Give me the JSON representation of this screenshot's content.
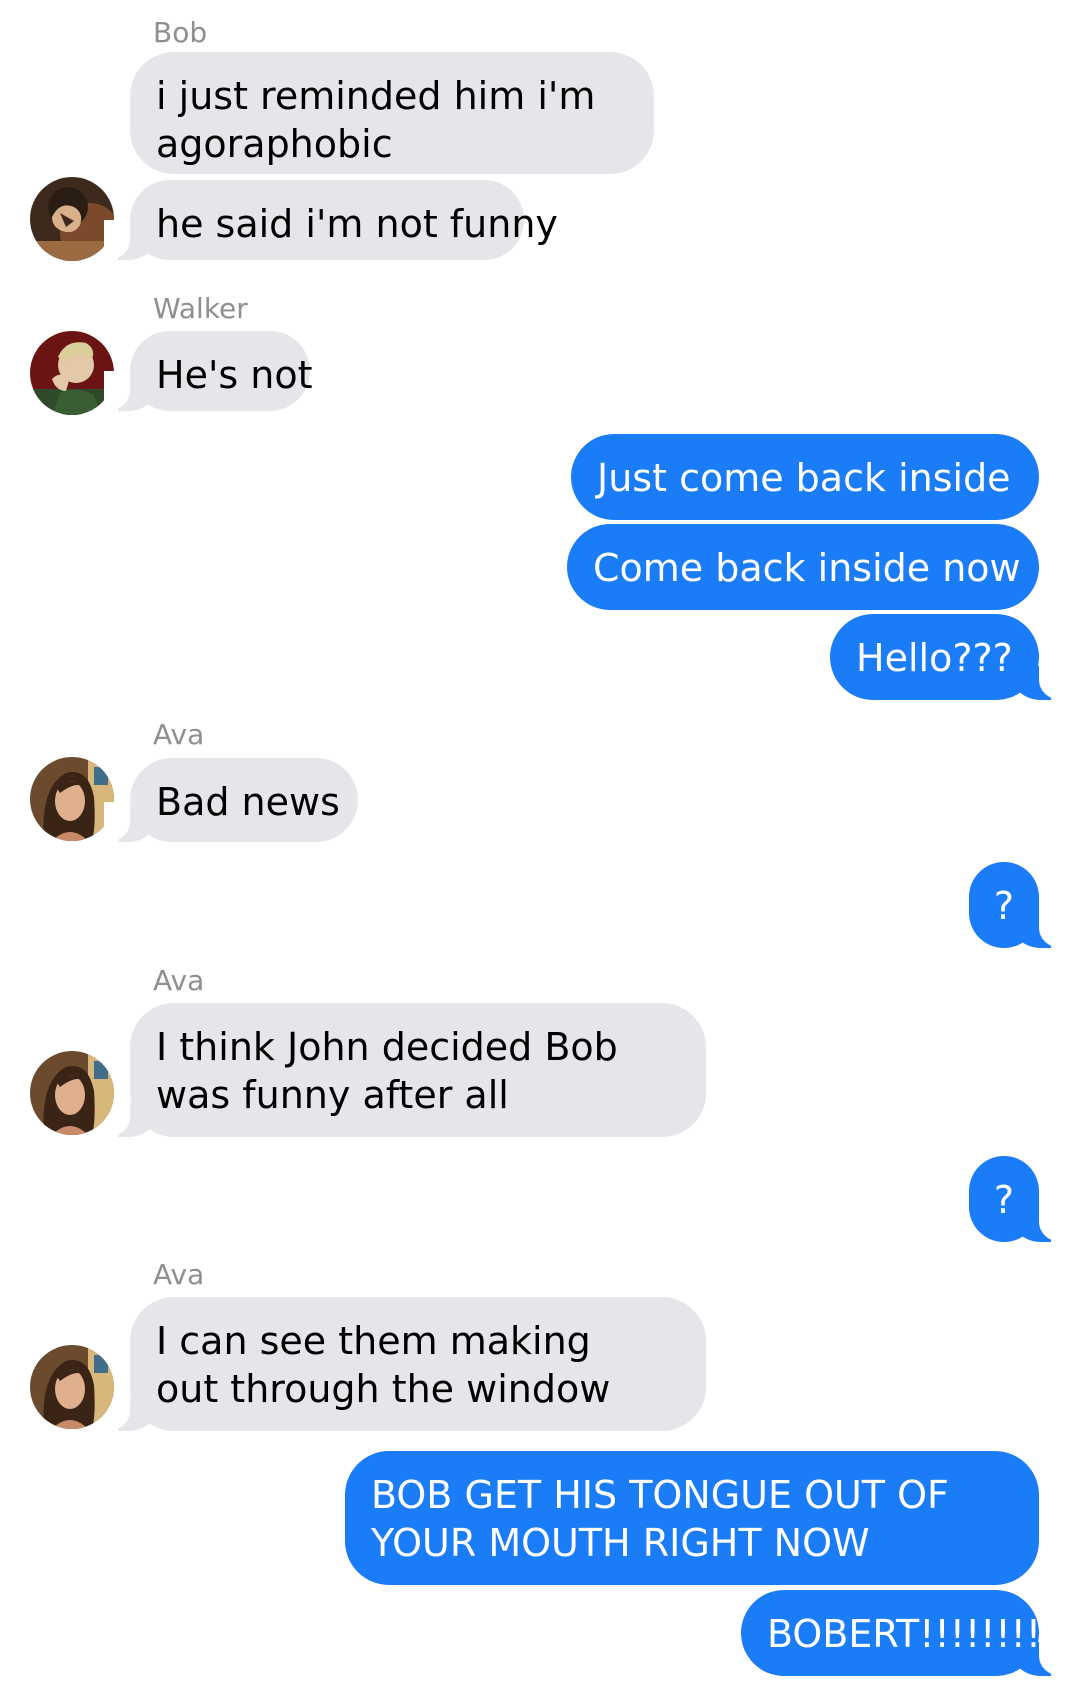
{
  "conversation": {
    "messages": [
      {
        "from": "Bob",
        "text": "i just reminded him i'm agoraphobic"
      },
      {
        "from": "Bob",
        "text": "he said i'm not funny"
      },
      {
        "from": "Walker",
        "text": "He's not"
      },
      {
        "from": "me",
        "text": "Just come back inside"
      },
      {
        "from": "me",
        "text": "Come back inside now"
      },
      {
        "from": "me",
        "text": "Hello???"
      },
      {
        "from": "Ava",
        "text": "Bad news"
      },
      {
        "from": "me",
        "text": "?"
      },
      {
        "from": "Ava",
        "text": "I think John decided Bob was funny after all"
      },
      {
        "from": "me",
        "text": "?"
      },
      {
        "from": "Ava",
        "text": "I can see them making out through the window"
      },
      {
        "from": "me",
        "text": "BOB GET HIS TONGUE OUT OF YOUR MOUTH RIGHT NOW"
      },
      {
        "from": "me",
        "text": "BOBERT!!!!!!!!"
      }
    ],
    "sender_labels": [
      "Bob",
      "Walker",
      "Ava",
      "Ava",
      "Ava"
    ]
  },
  "colors": {
    "incoming_bubble": "#e5e5ea",
    "outgoing_bubble": "#1a7cf6",
    "sender_label": "#8e8e93"
  },
  "avatars": [
    {
      "contact": "Bob",
      "icon": "avatar-photo-bob"
    },
    {
      "contact": "Walker",
      "icon": "avatar-photo-walker"
    },
    {
      "contact": "Ava",
      "icon": "avatar-photo-ava"
    },
    {
      "contact": "Ava",
      "icon": "avatar-photo-ava"
    },
    {
      "contact": "Ava",
      "icon": "avatar-photo-ava"
    }
  ]
}
